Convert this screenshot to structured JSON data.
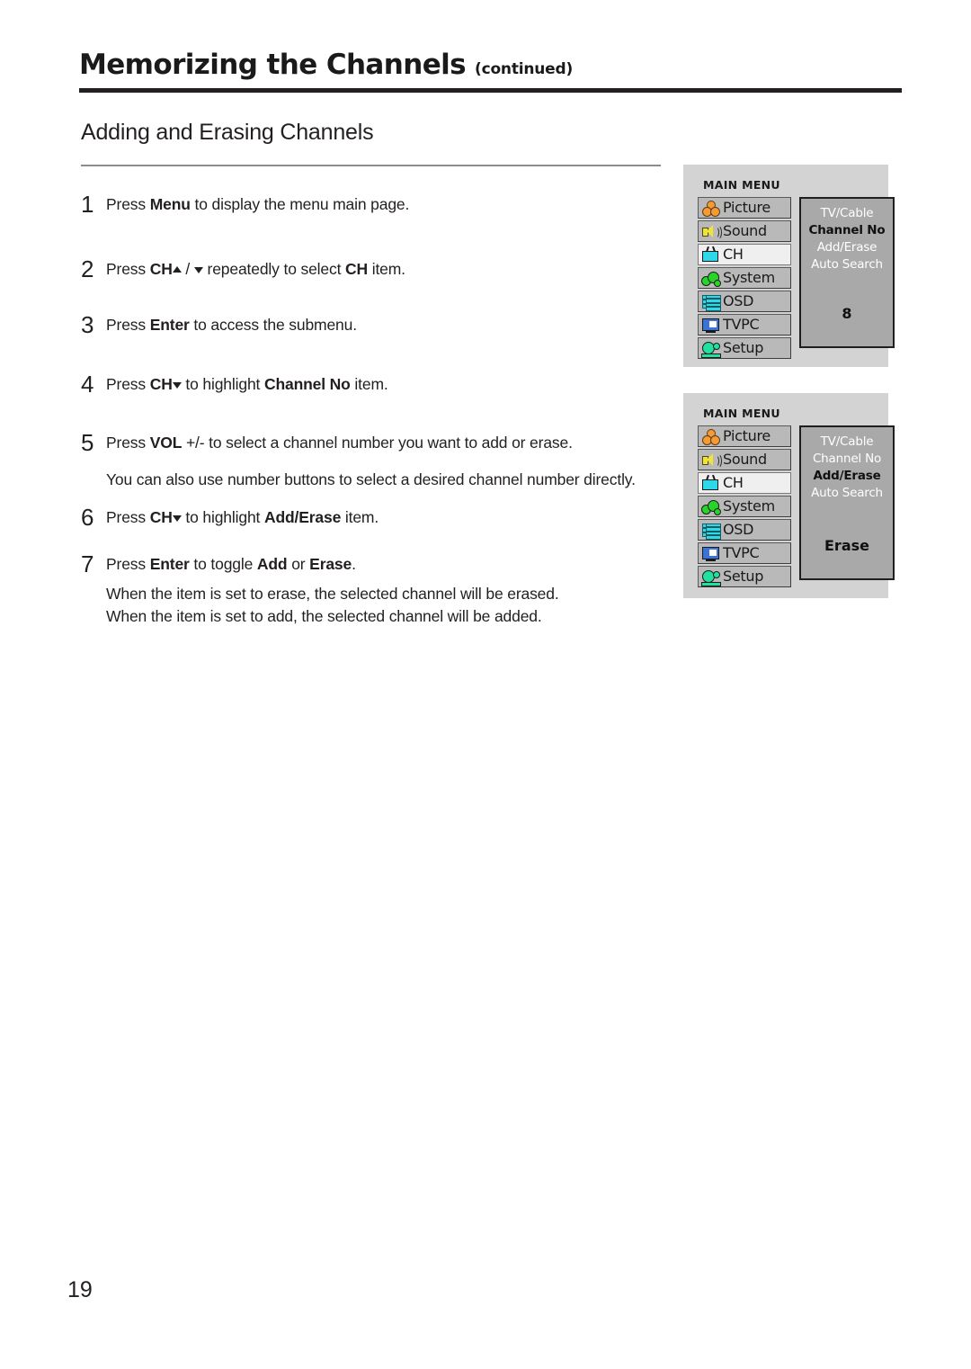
{
  "header": {
    "title": "Memorizing the Channels",
    "continued": "(continued)"
  },
  "section": {
    "heading": "Adding and Erasing Channels"
  },
  "steps": [
    {
      "number": "1",
      "parts": [
        {
          "t": "Press ",
          "b": false
        },
        {
          "t": "Menu",
          "b": true
        },
        {
          "t": " to display the menu main page.",
          "b": false
        }
      ]
    },
    {
      "number": "2",
      "parts": [
        {
          "t": "Press ",
          "b": false
        },
        {
          "t": "CH",
          "b": true
        },
        {
          "t": "ICON_UP",
          "b": false
        },
        {
          "t": " / ",
          "b": false
        },
        {
          "t": "ICON_DOWN",
          "b": false
        },
        {
          "t": "  repeatedly to select ",
          "b": false
        },
        {
          "t": "CH",
          "b": true
        },
        {
          "t": " item.",
          "b": false
        }
      ]
    },
    {
      "number": "3",
      "parts": [
        {
          "t": "Press ",
          "b": false
        },
        {
          "t": "Enter",
          "b": true
        },
        {
          "t": " to access the submenu.",
          "b": false
        }
      ]
    },
    {
      "number": "4",
      "parts": [
        {
          "t": "Press ",
          "b": false
        },
        {
          "t": "CH",
          "b": true
        },
        {
          "t": "ICON_DOWN",
          "b": false
        },
        {
          "t": " to highlight ",
          "b": false
        },
        {
          "t": "Channel No",
          "b": true
        },
        {
          "t": " item.",
          "b": false
        }
      ]
    },
    {
      "number": "5",
      "parts": [
        {
          "t": "Press ",
          "b": false
        },
        {
          "t": "VOL",
          "b": true
        },
        {
          "t": " +/- to select a channel number you want to add or erase.",
          "b": false
        }
      ],
      "note": "You can also use number buttons to select a desired channel number directly."
    },
    {
      "number": "6",
      "parts": [
        {
          "t": "Press ",
          "b": false
        },
        {
          "t": "CH",
          "b": true
        },
        {
          "t": "ICON_DOWN",
          "b": false
        },
        {
          "t": "  to highlight ",
          "b": false
        },
        {
          "t": "Add/Erase",
          "b": true
        },
        {
          "t": " item.",
          "b": false
        }
      ]
    },
    {
      "number": "7",
      "parts": [
        {
          "t": "Press ",
          "b": false
        },
        {
          "t": "Enter",
          "b": true
        },
        {
          "t": " to toggle ",
          "b": false
        },
        {
          "t": "Add",
          "b": true
        },
        {
          "t": " or ",
          "b": false
        },
        {
          "t": "Erase",
          "b": true
        },
        {
          "t": ".",
          "b": false
        }
      ],
      "note": "When the item is set to erase, the selected channel will be erased.",
      "note2": "When the item is set to add, the selected channel will be added."
    }
  ],
  "osd_menus": [
    {
      "title": "MAIN MENU",
      "items": [
        {
          "label": "Picture",
          "icon": "picture-icon",
          "selected": false
        },
        {
          "label": "Sound",
          "icon": "sound-icon",
          "selected": false
        },
        {
          "label": "CH",
          "icon": "tv-icon",
          "selected": true
        },
        {
          "label": "System",
          "icon": "system-icon",
          "selected": false
        },
        {
          "label": "OSD",
          "icon": "osd-icon",
          "selected": false
        },
        {
          "label": "TVPC",
          "icon": "monitor-icon",
          "selected": false
        },
        {
          "label": "Setup",
          "icon": "setup-icon",
          "selected": false
        }
      ],
      "submenu": [
        {
          "label": "TV/Cable",
          "highlighted": false
        },
        {
          "label": "Channel No",
          "highlighted": true
        },
        {
          "label": "Add/Erase",
          "highlighted": false
        },
        {
          "label": "Auto Search",
          "highlighted": false
        }
      ],
      "value": "8"
    },
    {
      "title": "MAIN MENU",
      "items": [
        {
          "label": "Picture",
          "icon": "picture-icon",
          "selected": false
        },
        {
          "label": "Sound",
          "icon": "sound-icon",
          "selected": false
        },
        {
          "label": "CH",
          "icon": "tv-icon",
          "selected": true
        },
        {
          "label": "System",
          "icon": "system-icon",
          "selected": false
        },
        {
          "label": "OSD",
          "icon": "osd-icon",
          "selected": false
        },
        {
          "label": "TVPC",
          "icon": "monitor-icon",
          "selected": false
        },
        {
          "label": "Setup",
          "icon": "setup-icon",
          "selected": false
        }
      ],
      "submenu": [
        {
          "label": "TV/Cable",
          "highlighted": false
        },
        {
          "label": "Channel No",
          "highlighted": false
        },
        {
          "label": "Add/Erase",
          "highlighted": true
        },
        {
          "label": "Auto Search",
          "highlighted": false
        }
      ],
      "value": "Erase"
    }
  ],
  "page_number": "19",
  "colors": {
    "text": "#231f20",
    "rule": "#231f20",
    "thin_rule": "#8c8c8c",
    "osd_background": "#d3d3d3",
    "osd_item": "#b9b9b9",
    "osd_item_selected": "#efefef",
    "osd_panel": "#a9a9a9",
    "picture_icon": "#f59a35",
    "sound_icon": "#f2e33a",
    "tv_icon": "#2fd8e8",
    "system_icon": "#27d427",
    "osd_icon": "#2fd8e8",
    "monitor_icon": "#3a72d8",
    "setup_icon": "#22e0a0"
  }
}
